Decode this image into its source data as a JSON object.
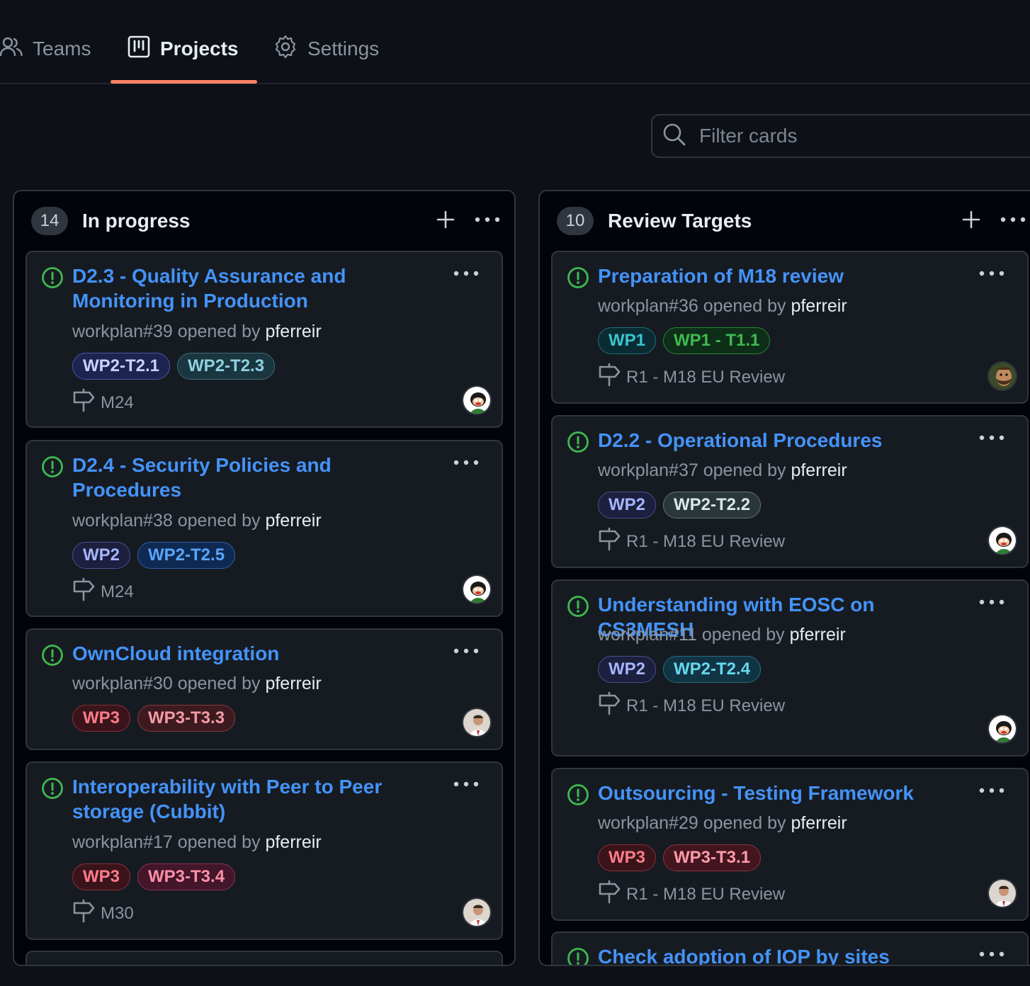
{
  "tabs": [
    {
      "label": "Teams",
      "icon": "people-icon"
    },
    {
      "label": "Projects",
      "icon": "project-board-icon",
      "active": true
    },
    {
      "label": "Settings",
      "icon": "gear-icon"
    }
  ],
  "filter": {
    "placeholder": "Filter cards",
    "value": ""
  },
  "columns": [
    {
      "count": "14",
      "title": "In progress",
      "cards": [
        {
          "title": "D2.3 - Quality Assurance and Monitoring in Production",
          "ref": "workplan#39",
          "opened_by_text": "opened by",
          "author": "pferreir",
          "labels": [
            "WP2-T2.1",
            "WP2-T2.3"
          ],
          "milestone": "M24",
          "avatar": "mascot"
        },
        {
          "title": "D2.4 - Security Policies and Procedures",
          "ref": "workplan#38",
          "opened_by_text": "opened by",
          "author": "pferreir",
          "labels": [
            "WP2",
            "WP2-T2.5"
          ],
          "milestone": "M24",
          "avatar": "mascot"
        },
        {
          "title": "OwnCloud integration",
          "ref": "workplan#30",
          "opened_by_text": "opened by",
          "author": "pferreir",
          "labels": [
            "WP3",
            "WP3-T3.3"
          ],
          "milestone": "",
          "avatar": "person"
        },
        {
          "title": "Interoperability with Peer to Peer storage (Cubbit)",
          "ref": "workplan#17",
          "opened_by_text": "opened by",
          "author": "pferreir",
          "labels": [
            "WP3",
            "WP3-T3.4"
          ],
          "milestone": "M30",
          "avatar": "person"
        }
      ]
    },
    {
      "count": "10",
      "title": "Review Targets",
      "cards": [
        {
          "title": "Preparation of M18 review",
          "ref": "workplan#36",
          "opened_by_text": "opened by",
          "author": "pferreir",
          "labels": [
            "WP1",
            "WP1 - T1.1"
          ],
          "milestone": "R1 - M18 EU Review",
          "avatar": "bearded"
        },
        {
          "title": "D2.2 - Operational Procedures",
          "ref": "workplan#37",
          "opened_by_text": "opened by",
          "author": "pferreir",
          "labels": [
            "WP2",
            "WP2-T2.2"
          ],
          "milestone": "R1 - M18 EU Review",
          "avatar": "mascot"
        },
        {
          "title": "Understanding with EOSC on CS3MESH",
          "ref": "workplan#11",
          "opened_by_text": "opened by",
          "author": "pferreir",
          "labels": [
            "WP2",
            "WP2-T2.4"
          ],
          "milestone": "R1 - M18 EU Review",
          "avatar": "mascot"
        },
        {
          "title": "Outsourcing - Testing Framework",
          "ref": "workplan#29",
          "opened_by_text": "opened by",
          "author": "pferreir",
          "labels": [
            "WP3",
            "WP3-T3.1"
          ],
          "milestone": "R1 - M18 EU Review",
          "avatar": "person"
        },
        {
          "title": "Check adoption of IOP by sites",
          "ref": "",
          "opened_by_text": "",
          "author": "",
          "labels": [],
          "milestone": "",
          "avatar": ""
        }
      ]
    }
  ],
  "label_colors": {
    "WP1": {
      "fg": "#39c5cf",
      "bg": "#0b2b33",
      "border": "#1f6f7a"
    },
    "WP1 - T1.1": {
      "fg": "#3fb950",
      "bg": "#0f2e18",
      "border": "#238636"
    },
    "WP2": {
      "fg": "#a5b4fc",
      "bg": "#1c1f3d",
      "border": "#4a4f8f"
    },
    "WP2-T2.1": {
      "fg": "#c7d2fe",
      "bg": "#1e2450",
      "border": "#4b56a8"
    },
    "WP2-T2.2": {
      "fg": "#d7e7ea",
      "bg": "#2b3638",
      "border": "#5e7478"
    },
    "WP2-T2.3": {
      "fg": "#8ed1e0",
      "bg": "#1a3640",
      "border": "#3d6b78"
    },
    "WP2-T2.4": {
      "fg": "#67d7f0",
      "bg": "#103444",
      "border": "#2a6c84"
    },
    "WP2-T2.5": {
      "fg": "#58a6ff",
      "bg": "#0f2a52",
      "border": "#2f5fa5"
    },
    "WP3": {
      "fg": "#ff7b8a",
      "bg": "#3a141a",
      "border": "#8a2f3a"
    },
    "WP3-T3.1": {
      "fg": "#ff9aa8",
      "bg": "#42151f",
      "border": "#8f3243"
    },
    "WP3-T3.3": {
      "fg": "#f29aa6",
      "bg": "#3d1a20",
      "border": "#873841"
    },
    "WP3-T3.4": {
      "fg": "#ff8fa6",
      "bg": "#43162a",
      "border": "#8c3150"
    }
  },
  "colors": {
    "accent_underline": "#f78166",
    "link": "#4493f8",
    "open_issue": "#3fb950"
  }
}
